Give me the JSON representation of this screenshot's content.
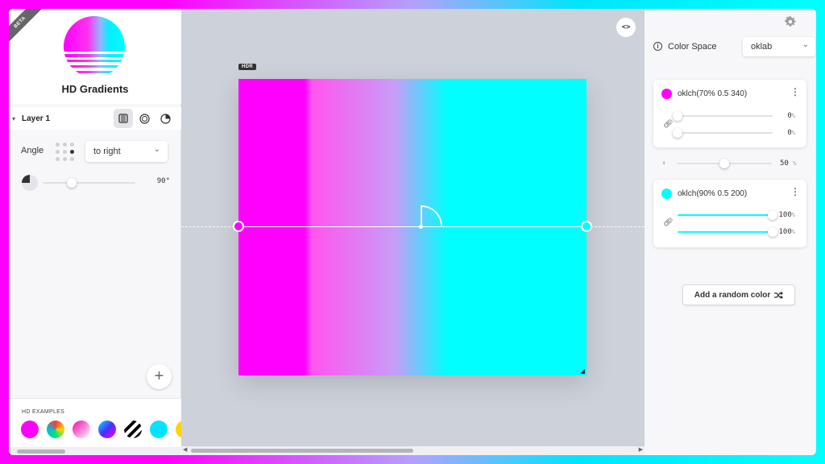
{
  "app": {
    "title": "HD Gradients",
    "badge": "BETA"
  },
  "layer": {
    "title": "Layer 1"
  },
  "angle": {
    "label": "Angle",
    "direction": "to right",
    "value": "90°",
    "fraction": 0.25
  },
  "examples": {
    "label": "HD EXAMPLES"
  },
  "canvas": {
    "hdr_badge": "HDR",
    "code_toggle": "<>"
  },
  "color_space": {
    "label": "Color Space",
    "value": "oklab"
  },
  "colors": [
    {
      "text": "oklch(70% 0.5 340)",
      "swatch": "#ff00ff",
      "start_value": "0",
      "end_value": "0",
      "unit": "%",
      "start_fraction": 0.0,
      "end_fraction": 0.0
    },
    {
      "text": "oklch(90% 0.5 200)",
      "swatch": "#00ffff",
      "start_value": "100",
      "end_value": "100",
      "unit": "%",
      "start_fraction": 1.0,
      "end_fraction": 1.0
    }
  ],
  "midpoint": {
    "value": "50",
    "unit": "%",
    "fraction": 0.5
  },
  "random_button": {
    "label": "Add a random color"
  },
  "theme": {
    "magenta": "#ff00ff",
    "cyan": "#00ffff"
  }
}
